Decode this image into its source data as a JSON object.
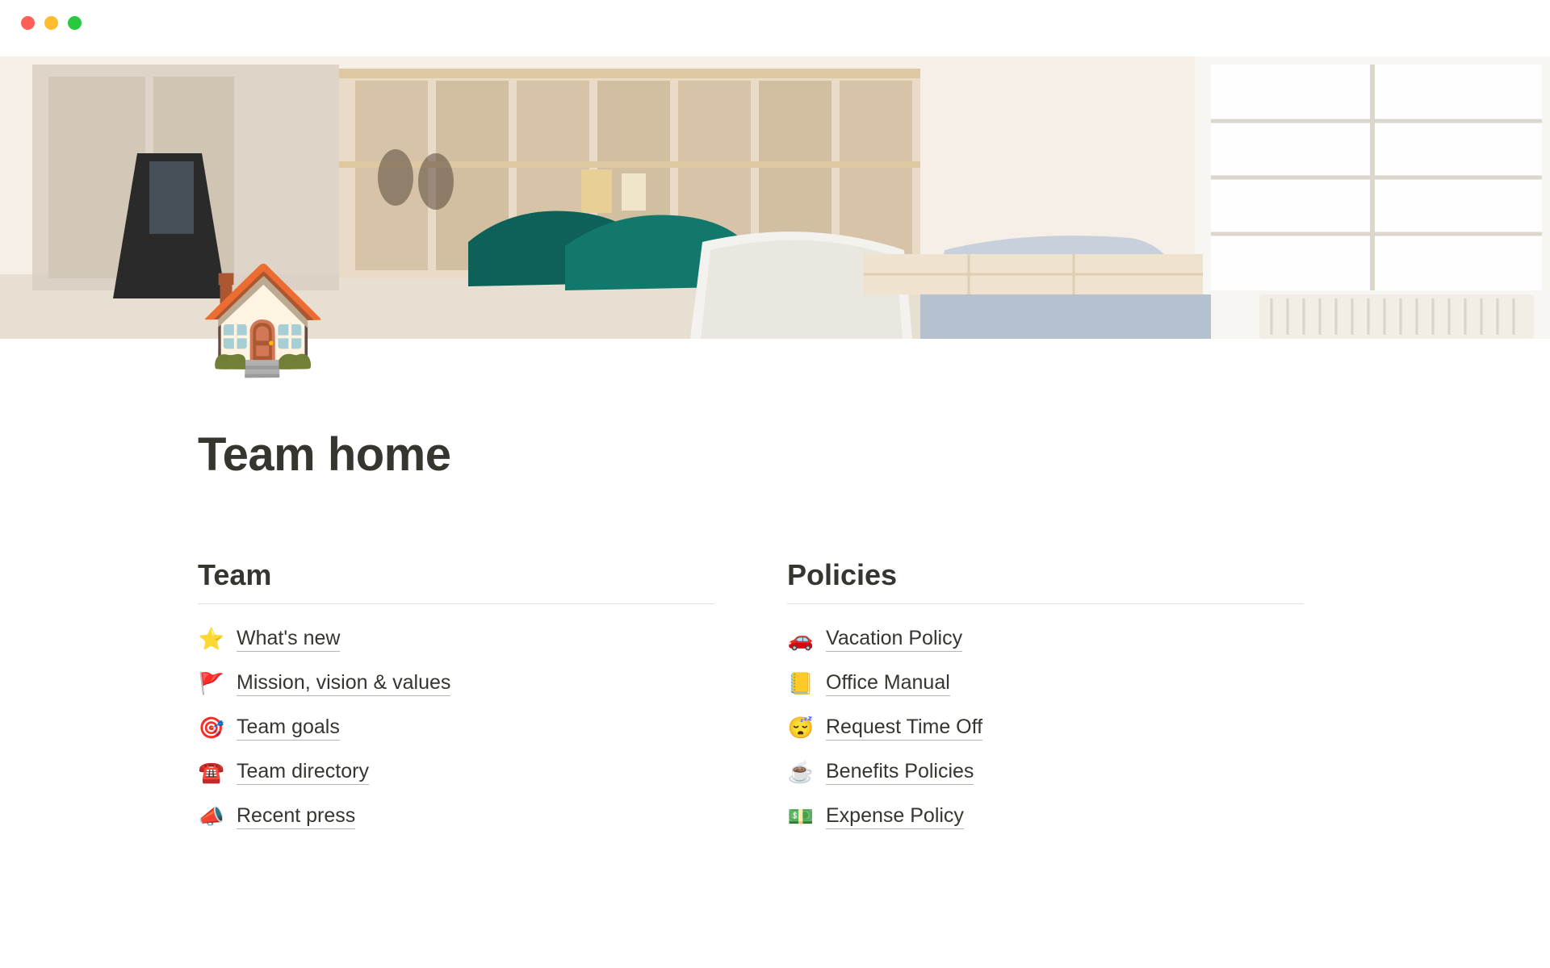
{
  "page": {
    "icon": "🏠",
    "title": "Team home"
  },
  "sections": {
    "team": {
      "heading": "Team",
      "items": [
        {
          "emoji": "⭐",
          "label": "What's new"
        },
        {
          "emoji": "🚩",
          "label": "Mission, vision & values"
        },
        {
          "emoji": "🎯",
          "label": "Team goals"
        },
        {
          "emoji": "☎️",
          "label": "Team directory"
        },
        {
          "emoji": "📣",
          "label": "Recent press"
        }
      ]
    },
    "policies": {
      "heading": "Policies",
      "items": [
        {
          "emoji": "🚗",
          "label": "Vacation Policy"
        },
        {
          "emoji": "📒",
          "label": "Office Manual"
        },
        {
          "emoji": "😴",
          "label": "Request Time Off"
        },
        {
          "emoji": "☕",
          "label": "Benefits Policies"
        },
        {
          "emoji": "💵",
          "label": "Expense Policy"
        }
      ]
    }
  }
}
